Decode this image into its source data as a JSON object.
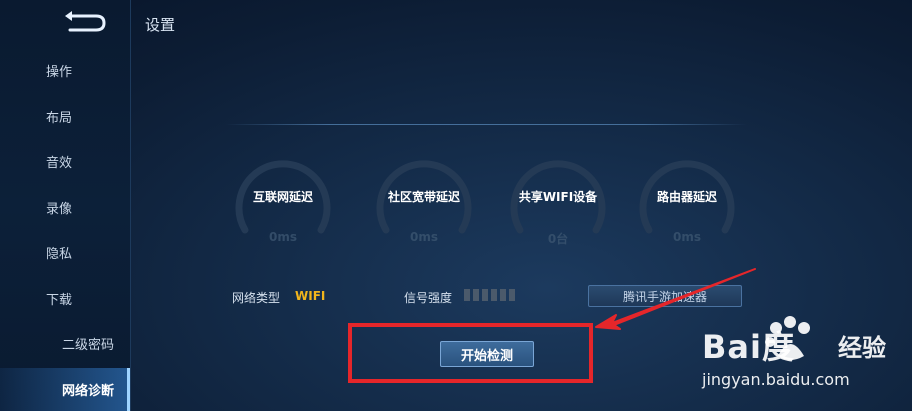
{
  "header": {
    "title": "设置"
  },
  "sidebar": {
    "items": [
      {
        "label": "操作"
      },
      {
        "label": "布局"
      },
      {
        "label": "音效"
      },
      {
        "label": "录像"
      },
      {
        "label": "隐私"
      },
      {
        "label": "下载"
      },
      {
        "label": "二级密码"
      },
      {
        "label": "网络诊断",
        "active": true
      }
    ]
  },
  "gauges": [
    {
      "label": "互联网延迟",
      "value": "0ms"
    },
    {
      "label": "社区宽带延迟",
      "value": "0ms"
    },
    {
      "label": "共享WIFI设备",
      "value": "0台"
    },
    {
      "label": "路由器延迟",
      "value": "0ms"
    }
  ],
  "network": {
    "type_label": "网络类型",
    "type_value": "WIFI",
    "signal_label": "信号强度",
    "signal_bars": 6,
    "signal_level": 0
  },
  "buttons": {
    "accelerator": "腾讯手游加速器",
    "start": "开始检测"
  },
  "watermark": {
    "logo": "Bai度",
    "brand": "经验",
    "url": "jingyan.baidu.com"
  },
  "colors": {
    "accent_yellow": "#f1b51c",
    "highlight_red": "#e5262a",
    "active_blue": "#2d6eb4"
  }
}
